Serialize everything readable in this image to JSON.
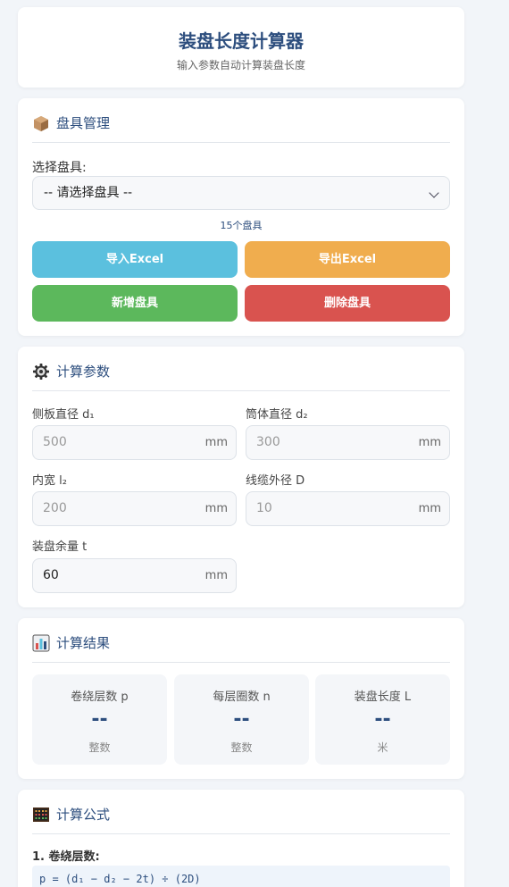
{
  "header": {
    "title": "装盘长度计算器",
    "subtitle": "输入参数自动计算装盘长度"
  },
  "reel": {
    "section_title": "盘具管理",
    "select_label": "选择盘具:",
    "select_value": "-- 请选择盘具 --",
    "count_text": "15个盘具",
    "buttons": {
      "import": "导入Excel",
      "export": "导出Excel",
      "add": "新增盘具",
      "delete": "删除盘具"
    }
  },
  "params": {
    "section_title": "计算参数",
    "fields": [
      {
        "label": "侧板直径 d₁",
        "value": "500",
        "unit": "mm"
      },
      {
        "label": "筒体直径 d₂",
        "value": "300",
        "unit": "mm"
      },
      {
        "label": "内宽 l₂",
        "value": "200",
        "unit": "mm"
      },
      {
        "label": "线缆外径 D",
        "value": "10",
        "unit": "mm"
      },
      {
        "label": "装盘余量 t",
        "value": "60",
        "unit": "mm"
      }
    ]
  },
  "results": {
    "section_title": "计算结果",
    "items": [
      {
        "name": "卷绕层数 p",
        "value": "--",
        "unit": "整数"
      },
      {
        "name": "每层圈数 n",
        "value": "--",
        "unit": "整数"
      },
      {
        "name": "装盘长度 L",
        "value": "--",
        "unit": "米"
      }
    ]
  },
  "formula": {
    "section_title": "计算公式",
    "items": [
      {
        "label": "1. 卷绕层数:",
        "code": "p = (d₁ − d₂ − 2t) ÷ (2D)"
      }
    ]
  },
  "colors": {
    "accent": "#2d4e7e",
    "import": "#5bc0de",
    "export": "#f0ad4e",
    "add": "#5cb85c",
    "delete": "#d9534f"
  }
}
